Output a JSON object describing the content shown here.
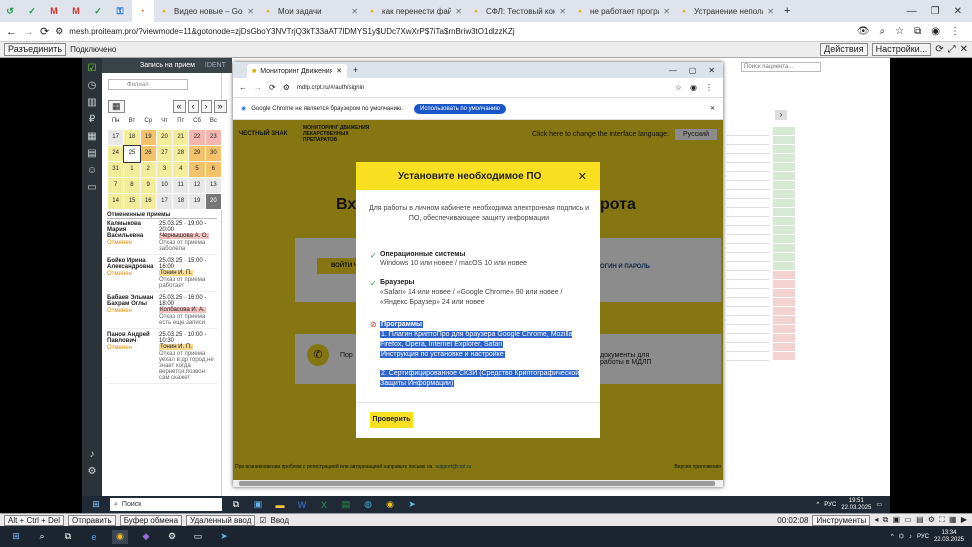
{
  "host_tabs": [
    {
      "label": ""
    },
    {
      "label": ""
    },
    {
      "label": ""
    },
    {
      "label": ""
    },
    {
      "label": ""
    },
    {
      "label": ""
    },
    {
      "label": ""
    },
    {
      "label": "Видео новые – Google Д"
    },
    {
      "label": "Мои задачи"
    },
    {
      "label": "как перенести файл дн"
    },
    {
      "label": "СФЛ: Тестовый контур"
    },
    {
      "label": "не работает программ"
    },
    {
      "label": "Устранение неполадок"
    }
  ],
  "host_url": "mesh.proiteam.pro/?viewmode=11&gotonode=zjDsGboY3NVTrjQ3kT33aAT7lDMYS1y$UDc7XwXrP$7iTa$rnBriw3tO1dlzzKZj",
  "rdp_bar": {
    "unlock": "Разъединить",
    "status": "Подключено",
    "actions": "Действия",
    "settings": "Настройки..."
  },
  "remote_app": {
    "window_title": "Запись на прием",
    "app_name": "IDENT",
    "filial": "Филиал",
    "weekdays": [
      "Пн",
      "Вт",
      "Ср",
      "Чт",
      "Пт",
      "Сб",
      "Вс"
    ],
    "cal_rows": [
      [
        {
          "d": "17",
          "c": "g"
        },
        {
          "d": "18",
          "c": "y"
        },
        {
          "d": "19",
          "c": "o"
        },
        {
          "d": "20",
          "c": "y"
        },
        {
          "d": "21",
          "c": "y"
        },
        {
          "d": "22",
          "c": "p"
        },
        {
          "d": "23",
          "c": "p"
        }
      ],
      [
        {
          "d": "24",
          "c": "y"
        },
        {
          "d": "25",
          "c": "bl"
        },
        {
          "d": "26",
          "c": "o"
        },
        {
          "d": "27",
          "c": "y"
        },
        {
          "d": "28",
          "c": "y"
        },
        {
          "d": "29",
          "c": "o"
        },
        {
          "d": "30",
          "c": "o"
        }
      ],
      [
        {
          "d": "31",
          "c": "y"
        },
        {
          "d": "1",
          "c": "y"
        },
        {
          "d": "2",
          "c": "y"
        },
        {
          "d": "3",
          "c": "y"
        },
        {
          "d": "4",
          "c": "y"
        },
        {
          "d": "5",
          "c": "o"
        },
        {
          "d": "6",
          "c": "o"
        }
      ],
      [
        {
          "d": "7",
          "c": "y"
        },
        {
          "d": "8",
          "c": "y"
        },
        {
          "d": "9",
          "c": "y"
        },
        {
          "d": "10",
          "c": "g"
        },
        {
          "d": "11",
          "c": "g"
        },
        {
          "d": "12",
          "c": "g"
        },
        {
          "d": "13",
          "c": "g"
        }
      ],
      [
        {
          "d": "14",
          "c": "y"
        },
        {
          "d": "15",
          "c": "y"
        },
        {
          "d": "16",
          "c": "y"
        },
        {
          "d": "17",
          "c": "g"
        },
        {
          "d": "18",
          "c": "g"
        },
        {
          "d": "19",
          "c": "g"
        },
        {
          "d": "20",
          "c": "dk"
        }
      ]
    ],
    "cancel_header": "Отмененные приемы",
    "cancelled": [
      {
        "name": "Калмыкова Мария Васильевна",
        "when": "25.03.25 · 19:00 - 20:00",
        "doc": "Чернышова А. О.",
        "status": "Отменен",
        "reason": "Отказ от приема заболела"
      },
      {
        "name": "Бойко Ирина Александровна",
        "when": "25.03.25 · 15:00 - 16:00",
        "doc": "Тонин И. П.",
        "status": "Отменен",
        "reason": "Отказ от приема работает"
      },
      {
        "name": "Бабаев Эльман Бахрам Оглы",
        "when": "25.03.25 · 16:00 - 18:00",
        "doc": "Колбасова И. А.",
        "status": "Отменен",
        "reason": "Отказ от приема есть еще записи"
      },
      {
        "name": "Панов Андрей Павлович",
        "when": "25.03.25 · 10:00 - 10:30",
        "doc": "Тонин И. П.",
        "status": "Отменен",
        "reason": "Отказ от приема уехал в др город,не знает когда вернется,позвон сам скажет"
      }
    ],
    "search_patient": "Поиск пациента..."
  },
  "browser": {
    "tab_title": "Мониторинг Движения Лекс",
    "url": "mdlp.crpt.ru/#/auth/signin",
    "notice": "Google Chrome не является браузером по умолчанию.",
    "notice_btn": "Использовать по умолчанию",
    "site_logo": "ЧЕСТНЫЙ ЗНАК",
    "site_title": "МОНИТОРИНГ ДВИЖЕНИЯ ЛЕКАРСТВЕННЫХ ПРЕПАРАТОВ",
    "lang_text": "Click here to change the interface language:",
    "lang": "Русский",
    "bg_heading_l": "Вхо",
    "bg_heading_r": "рота",
    "bg_btn": "ВОЙТИ Ч",
    "bg_link": "ОГИН И ПАРОЛЬ",
    "bg_support": "Пор",
    "bg_docs": "документы для работы в МДЛП",
    "footer": "При возникновении проблем с регистрацией или авторизацией направьте письмо на",
    "footer_mail": "support@crpt.ru",
    "footer_right": "Версия приложения"
  },
  "modal": {
    "title": "Установите необходимое ПО",
    "intro": "Для работы в личном кабинете необходима электронная подпись и ПО, обеспечивающее защиту информации",
    "os_title": "Операционные системы",
    "os_text": "Windows 10 или новее / macOS 10 или новее",
    "br_title": "Браузеры",
    "br_text": "«Safari» 14 или новее / «Google Chrome» 90 или новее / «Яндекс Браузер» 24 или новее",
    "prog_title": "Программы",
    "prog_1": "1. Плагин КриптоПро для браузера Google Chrome, Mozilla Firefox, Opera, Internet Explorer, Safari",
    "prog_link": "Инструкция по установке и настройке",
    "prog_2": "2. Сертифицированное СКЗИ (Средство Криптографической Защиты Информации)",
    "check_btn": "Проверить"
  },
  "remote_taskbar": {
    "search": "Поиск",
    "lang": "РУС",
    "time": "19:51",
    "date": "22.03.2025"
  },
  "host_bar": {
    "keys": "Alt + Ctrl + Del",
    "send": "Отправить",
    "clipboard": "Буфер обмена",
    "remote": "Удаленный ввод",
    "input": "Ввод",
    "timer": "00:02:08",
    "tools": "Инструменты"
  },
  "win_taskbar": {
    "lang": "РУС",
    "time": "13:34",
    "date": "22.03.2025"
  }
}
